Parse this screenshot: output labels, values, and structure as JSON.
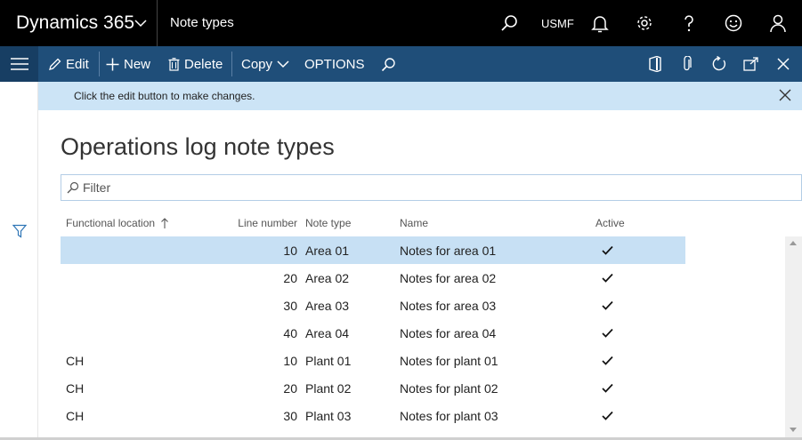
{
  "topbar": {
    "brand": "Dynamics 365",
    "page_name": "Note types",
    "company": "USMF",
    "icons": [
      "search-icon",
      "bell-icon",
      "gear-icon",
      "help-icon",
      "smiley-icon",
      "user-icon"
    ]
  },
  "actions": {
    "edit": "Edit",
    "new": "New",
    "delete": "Delete",
    "copy": "Copy",
    "options": "OPTIONS"
  },
  "message": {
    "text": "Click the edit button to make changes."
  },
  "page": {
    "title": "Operations log note types",
    "filter_placeholder": "Filter"
  },
  "grid": {
    "columns": {
      "location": "Functional location",
      "line": "Line number",
      "type": "Note type",
      "name": "Name",
      "active": "Active"
    },
    "rows": [
      {
        "location": "",
        "line": "10",
        "type": "Area 01",
        "name": "Notes for area 01",
        "active": true,
        "selected": true
      },
      {
        "location": "",
        "line": "20",
        "type": "Area 02",
        "name": "Notes for area 02",
        "active": true
      },
      {
        "location": "",
        "line": "30",
        "type": "Area 03",
        "name": "Notes for area 03",
        "active": true
      },
      {
        "location": "",
        "line": "40",
        "type": "Area 04",
        "name": "Notes for area 04",
        "active": true
      },
      {
        "location": "CH",
        "line": "10",
        "type": "Plant 01",
        "name": "Notes for plant 01",
        "active": true
      },
      {
        "location": "CH",
        "line": "20",
        "type": "Plant 02",
        "name": "Notes for plant 02",
        "active": true
      },
      {
        "location": "CH",
        "line": "30",
        "type": "Plant 03",
        "name": "Notes for plant 03",
        "active": true
      }
    ]
  },
  "colors": {
    "nav": "#000000",
    "action_pane": "#1f4e79",
    "message_bar": "#cce4f6",
    "selected_row": "#c7e0f4"
  }
}
